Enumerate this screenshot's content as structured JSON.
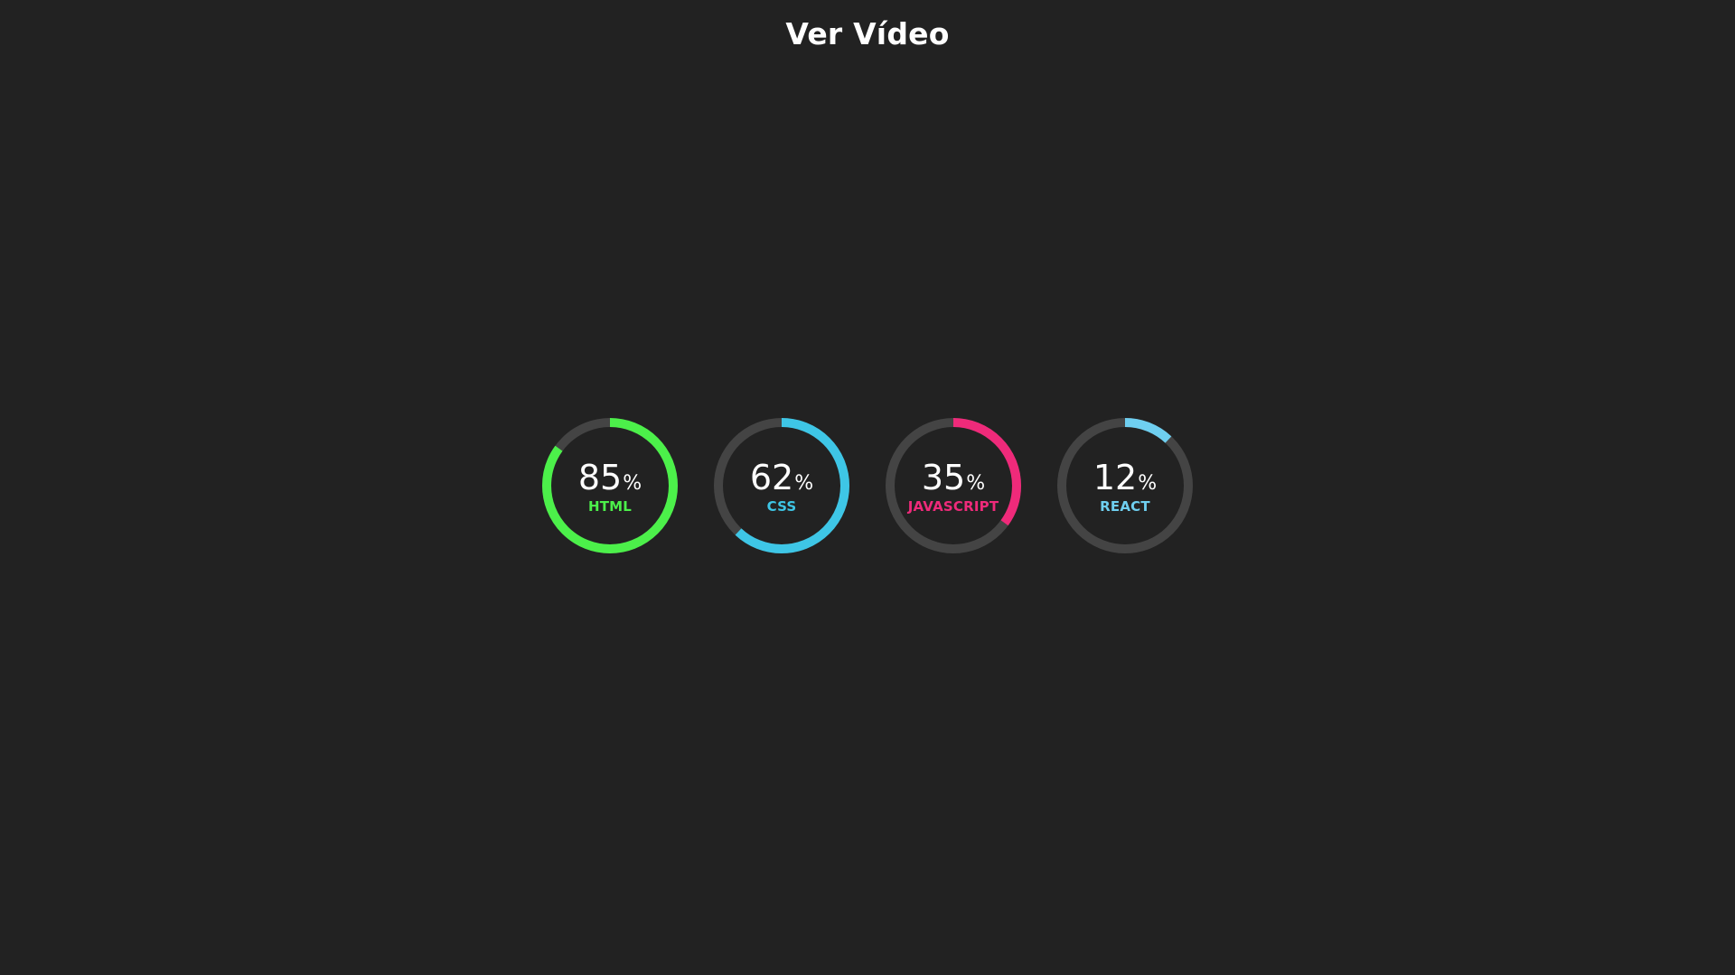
{
  "header": {
    "title": "Ver Vídeo"
  },
  "colors": {
    "background": "#222222",
    "track": "#444444"
  },
  "skills": [
    {
      "label": "HTML",
      "value": "85",
      "unit": "%",
      "fraction": 0.85,
      "color": "#4cf04a",
      "icon": "progress-ring"
    },
    {
      "label": "CSS",
      "value": "62",
      "unit": "%",
      "fraction": 0.62,
      "color": "#3ec6e6",
      "icon": "progress-ring"
    },
    {
      "label": "JAVASCRIPT",
      "value": "35",
      "unit": "%",
      "fraction": 0.35,
      "color": "#ef2a7a",
      "icon": "progress-ring"
    },
    {
      "label": "REACT",
      "value": "12",
      "unit": "%",
      "fraction": 0.12,
      "color": "#6fcff0",
      "icon": "progress-ring"
    }
  ]
}
